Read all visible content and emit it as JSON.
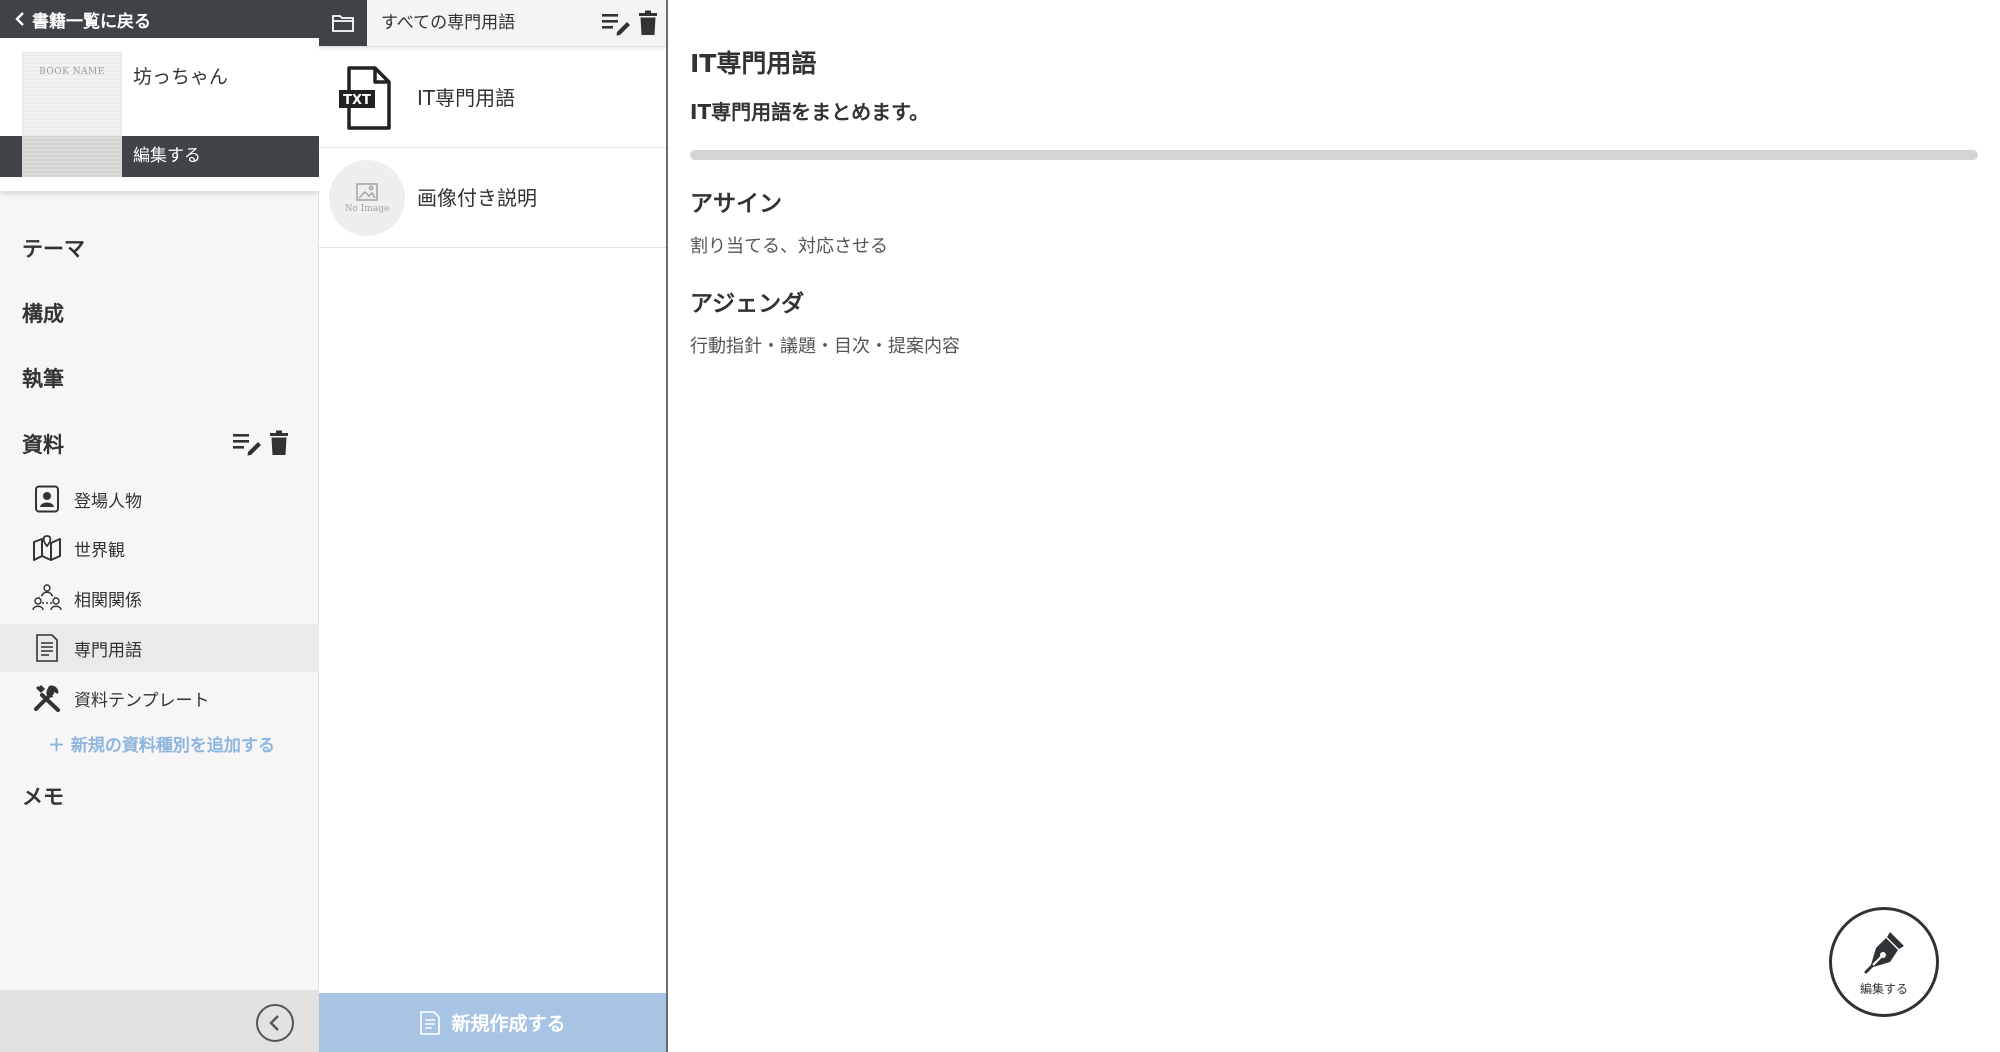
{
  "sidebar": {
    "back_label": "書籍一覧に戻る",
    "book": {
      "cover_label": "BOOK NAME",
      "title": "坊っちゃん",
      "edit_label": "編集する"
    },
    "nav": {
      "theme": "テーマ",
      "structure": "構成",
      "writing": "執筆",
      "materials": "資料",
      "memo": "メモ"
    },
    "materials_items": [
      {
        "label": "登場人物",
        "icon": "character-card-icon"
      },
      {
        "label": "世界観",
        "icon": "map-icon"
      },
      {
        "label": "相関関係",
        "icon": "relationship-icon"
      },
      {
        "label": "専門用語",
        "icon": "glossary-document-icon",
        "active": true
      },
      {
        "label": "資料テンプレート",
        "icon": "tools-icon"
      }
    ],
    "add_material_type": "＋ 新規の資料種別を追加する"
  },
  "list_pane": {
    "filter_label": "すべての専門用語",
    "items": [
      {
        "label": "IT専門用語",
        "thumb": "txt-file-icon"
      },
      {
        "label": "画像付き説明",
        "thumb": "no-image-placeholder",
        "thumb_text": "No Image"
      }
    ],
    "new_button_label": "新規作成する"
  },
  "main": {
    "title": "IT専門用語",
    "description": "IT専門用語をまとめます。",
    "terms": [
      {
        "name": "アサイン",
        "description": "割り当てる、対応させる"
      },
      {
        "name": "アジェンダ",
        "description": "行動指針・議題・目次・提案内容"
      }
    ],
    "fab_label": "編集する"
  },
  "colors": {
    "dark_header": "#3e4347",
    "accent_blue": "#a7c4e4",
    "link_blue": "#8fb6df",
    "active_row": "#e9eaea"
  }
}
